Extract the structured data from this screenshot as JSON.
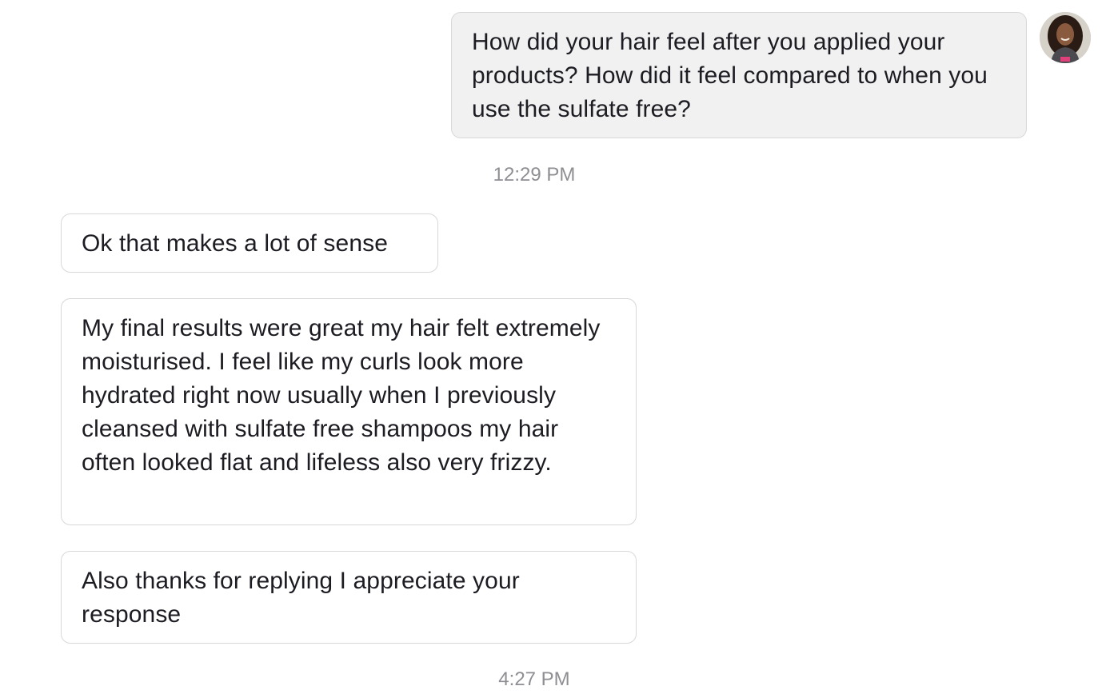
{
  "conversation": {
    "messages": [
      {
        "sender": "user",
        "text": "How did your hair feel after you applied your products? How did it feel compared to when you use the sulfate free?"
      },
      {
        "sender": "contact",
        "text": "Ok that makes a lot of sense"
      },
      {
        "sender": "contact",
        "text": "My final results were great my hair felt extremely moisturised. I feel like my curls look more hydrated right now usually when I previously cleansed with sulfate free shampoos my hair often looked flat and lifeless also very frizzy."
      },
      {
        "sender": "contact",
        "text": "Also thanks for replying I appreciate your response"
      }
    ],
    "timestamps": [
      "12:29 PM",
      "4:27 PM"
    ]
  },
  "colors": {
    "outgoing_bubble": "#f1f1f1",
    "incoming_bubble": "#ffffff",
    "bubble_border": "#d8d8da",
    "timestamp": "#8e8e93"
  }
}
